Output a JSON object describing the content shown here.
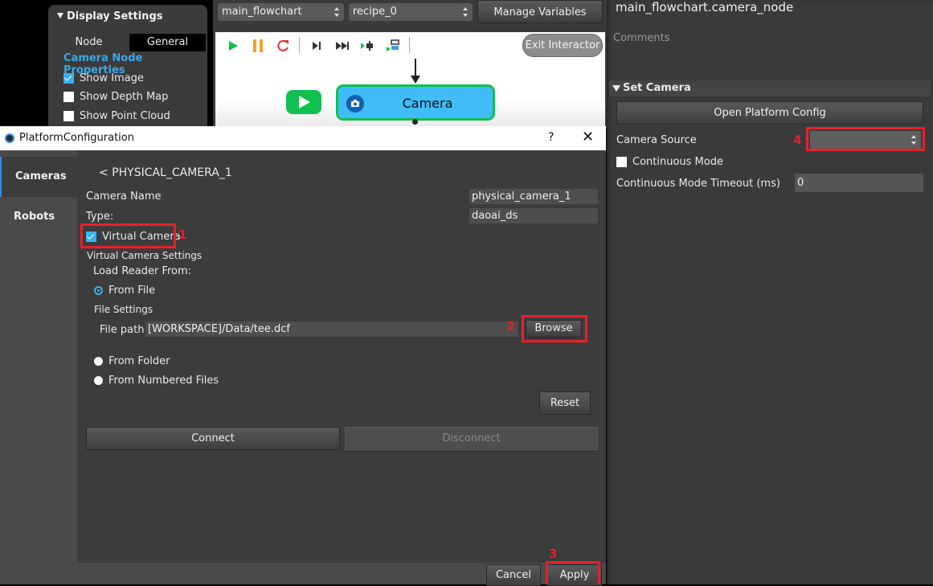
{
  "display_settings": {
    "header": "Display Settings",
    "tabs": [
      "Node",
      "General"
    ],
    "section_title": "Camera Node Properties",
    "checkboxes": [
      {
        "label": "Show Image",
        "checked": true
      },
      {
        "label": "Show Depth Map",
        "checked": false
      },
      {
        "label": "Show Point Cloud",
        "checked": false
      }
    ]
  },
  "top_bar": {
    "flowchart_select": "main_flowchart",
    "recipe_select": "recipe_0",
    "manage_variables_label": "Manage Variables"
  },
  "canvas": {
    "toolbar_icons": [
      "play-icon",
      "pause-icon",
      "restart-icon",
      "step-icon",
      "fast-forward-icon",
      "run-to-breakpoint-icon",
      "run-to-node-icon"
    ],
    "exit_interactor_label": "Exit Interactor",
    "camera_node_label": "Camera"
  },
  "right_panel": {
    "title": "main_flowchart.camera_node",
    "comments_label": "Comments",
    "set_camera_header": "Set Camera",
    "open_platform_config_label": "Open Platform Config",
    "camera_source_label": "Camera Source",
    "camera_source_value": "",
    "continuous_mode_label": "Continuous Mode",
    "continuous_mode_checked": false,
    "continuous_timeout_label": "Continuous Mode Timeout (ms)",
    "continuous_timeout_value": "0"
  },
  "dialog": {
    "title": "PlatformConfiguration",
    "help": "?",
    "close": "✕",
    "sidebar": [
      {
        "label": "Cameras",
        "active": true
      },
      {
        "label": "Robots",
        "active": false
      }
    ],
    "back_label": "<  PHYSICAL_CAMERA_1",
    "camera_name_label": "Camera Name",
    "camera_name_value": "physical_camera_1",
    "type_label": "Type:",
    "type_value": "daoai_ds",
    "virtual_camera_label": "Virtual Camera",
    "virtual_camera_checked": true,
    "virtual_camera_settings_label": "Virtual Camera Settings",
    "load_reader_label": "Load Reader From:",
    "from_file_label": "From File",
    "file_settings_label": "File Settings",
    "file_path_label": "File path:",
    "file_path_value": "[WORKSPACE]/Data/tee.dcf",
    "browse_label": "Browse",
    "from_folder_label": "From Folder",
    "from_numbered_label": "From Numbered Files",
    "selected_source": "From File",
    "reset_label": "Reset",
    "connect_label": "Connect",
    "disconnect_label": "Disconnect",
    "cancel_label": "Cancel",
    "apply_label": "Apply"
  },
  "annotations": {
    "color": "#e8202a",
    "steps": [
      "1",
      "2",
      "3",
      "4"
    ]
  }
}
